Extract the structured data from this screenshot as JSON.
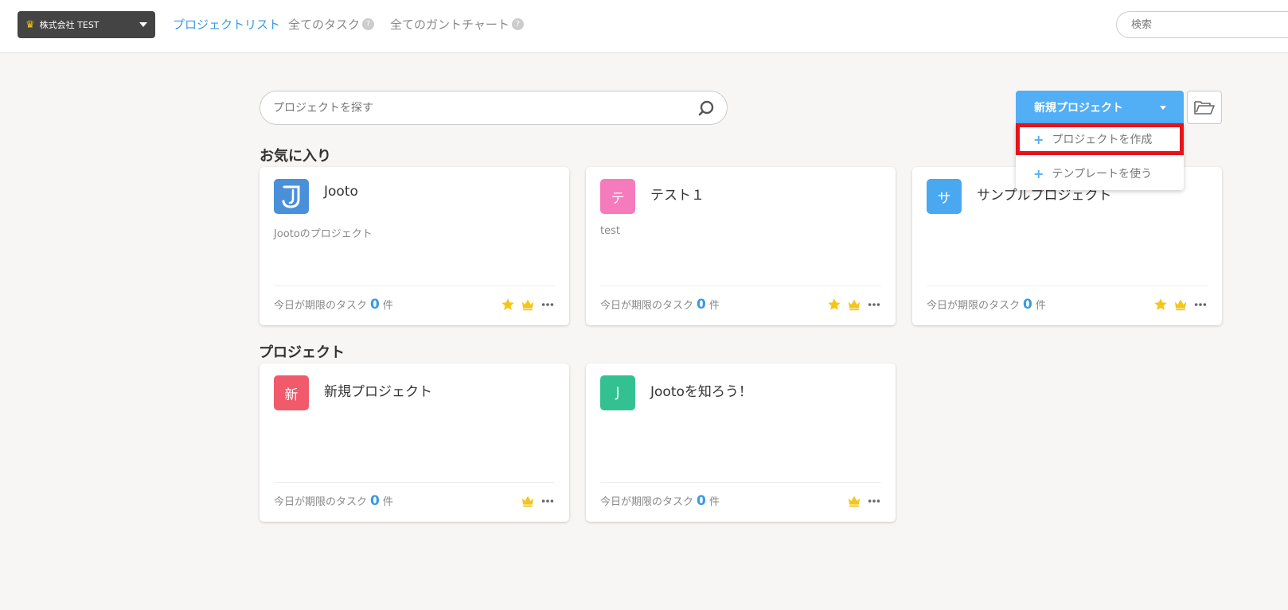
{
  "header": {
    "org_name": "株式会社 TEST",
    "nav": {
      "project_list": "プロジェクトリスト",
      "all_tasks": "全てのタスク",
      "all_gantt": "全てのガントチャート",
      "help_glyph": "?"
    },
    "search_placeholder": "検索"
  },
  "toolbar": {
    "search_placeholder": "プロジェクトを探す",
    "new_project_label": "新規プロジェクト",
    "dropdown": {
      "create_project": "プロジェクトを作成",
      "use_template": "テンプレートを使う",
      "plus_glyph": "+"
    }
  },
  "sections": {
    "favorites": "お気に入り",
    "projects": "プロジェクト"
  },
  "footer_text": {
    "prefix": "今日が期限のタスク",
    "suffix": "件"
  },
  "favorites": [
    {
      "title": "Jooto",
      "initial": "",
      "description": "Jootoのプロジェクト",
      "count": "0",
      "color": "#4a90d9"
    },
    {
      "title": "テスト１",
      "initial": "テ",
      "description": "test",
      "count": "0",
      "color": "#f67bbd"
    },
    {
      "title": "サンプルプロジェクト",
      "initial": "サ",
      "description": "",
      "count": "0",
      "color": "#4aa8f0"
    }
  ],
  "projects": [
    {
      "title": "新規プロジェクト",
      "initial": "新",
      "description": "",
      "count": "0",
      "color": "#f05a6a"
    },
    {
      "title": "Jootoを知ろう！",
      "initial": "J",
      "description": "",
      "count": "0",
      "color": "#33c192"
    }
  ],
  "colors": {
    "accent": "#52aef5",
    "link": "#3b9ae1",
    "highlight_border": "#e8121a",
    "star": "#f5c518"
  }
}
